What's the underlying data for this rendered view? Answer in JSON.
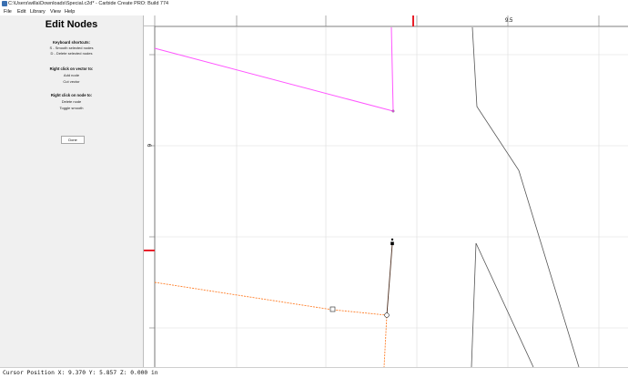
{
  "window": {
    "title": "C:\\Users\\willa\\Downloads\\Special.c2d* - Carbide Create PRO: Build 774"
  },
  "menu": {
    "items": [
      "File",
      "Edit",
      "Library",
      "View",
      "Help"
    ]
  },
  "panel": {
    "title": "Edit Nodes",
    "shortcuts": {
      "heading": "Keyboard shortcuts:",
      "lines": [
        "S - Smooth selected nodes",
        "D - Delete selected nodes"
      ]
    },
    "vector_menu": {
      "heading": "Right click on vector to:",
      "lines": [
        "Add node",
        "Cut vector"
      ]
    },
    "node_menu": {
      "heading": "Right click on node to:",
      "lines": [
        "Delete node",
        "Toggle smooth"
      ]
    },
    "done_label": "Done"
  },
  "rulers": {
    "top_label": "9.5",
    "left_label": "6"
  },
  "colors": {
    "magenta_vector": "#ff55ff",
    "orange_vector": "#ff7f2a",
    "gray_vector": "#555555",
    "ruler_marker": "#e8202a",
    "grid": "#d8d8d8"
  },
  "status": {
    "cursor_position": "Cursor Position X: 9.370 Y: 5.857 Z: 0.000 in"
  }
}
